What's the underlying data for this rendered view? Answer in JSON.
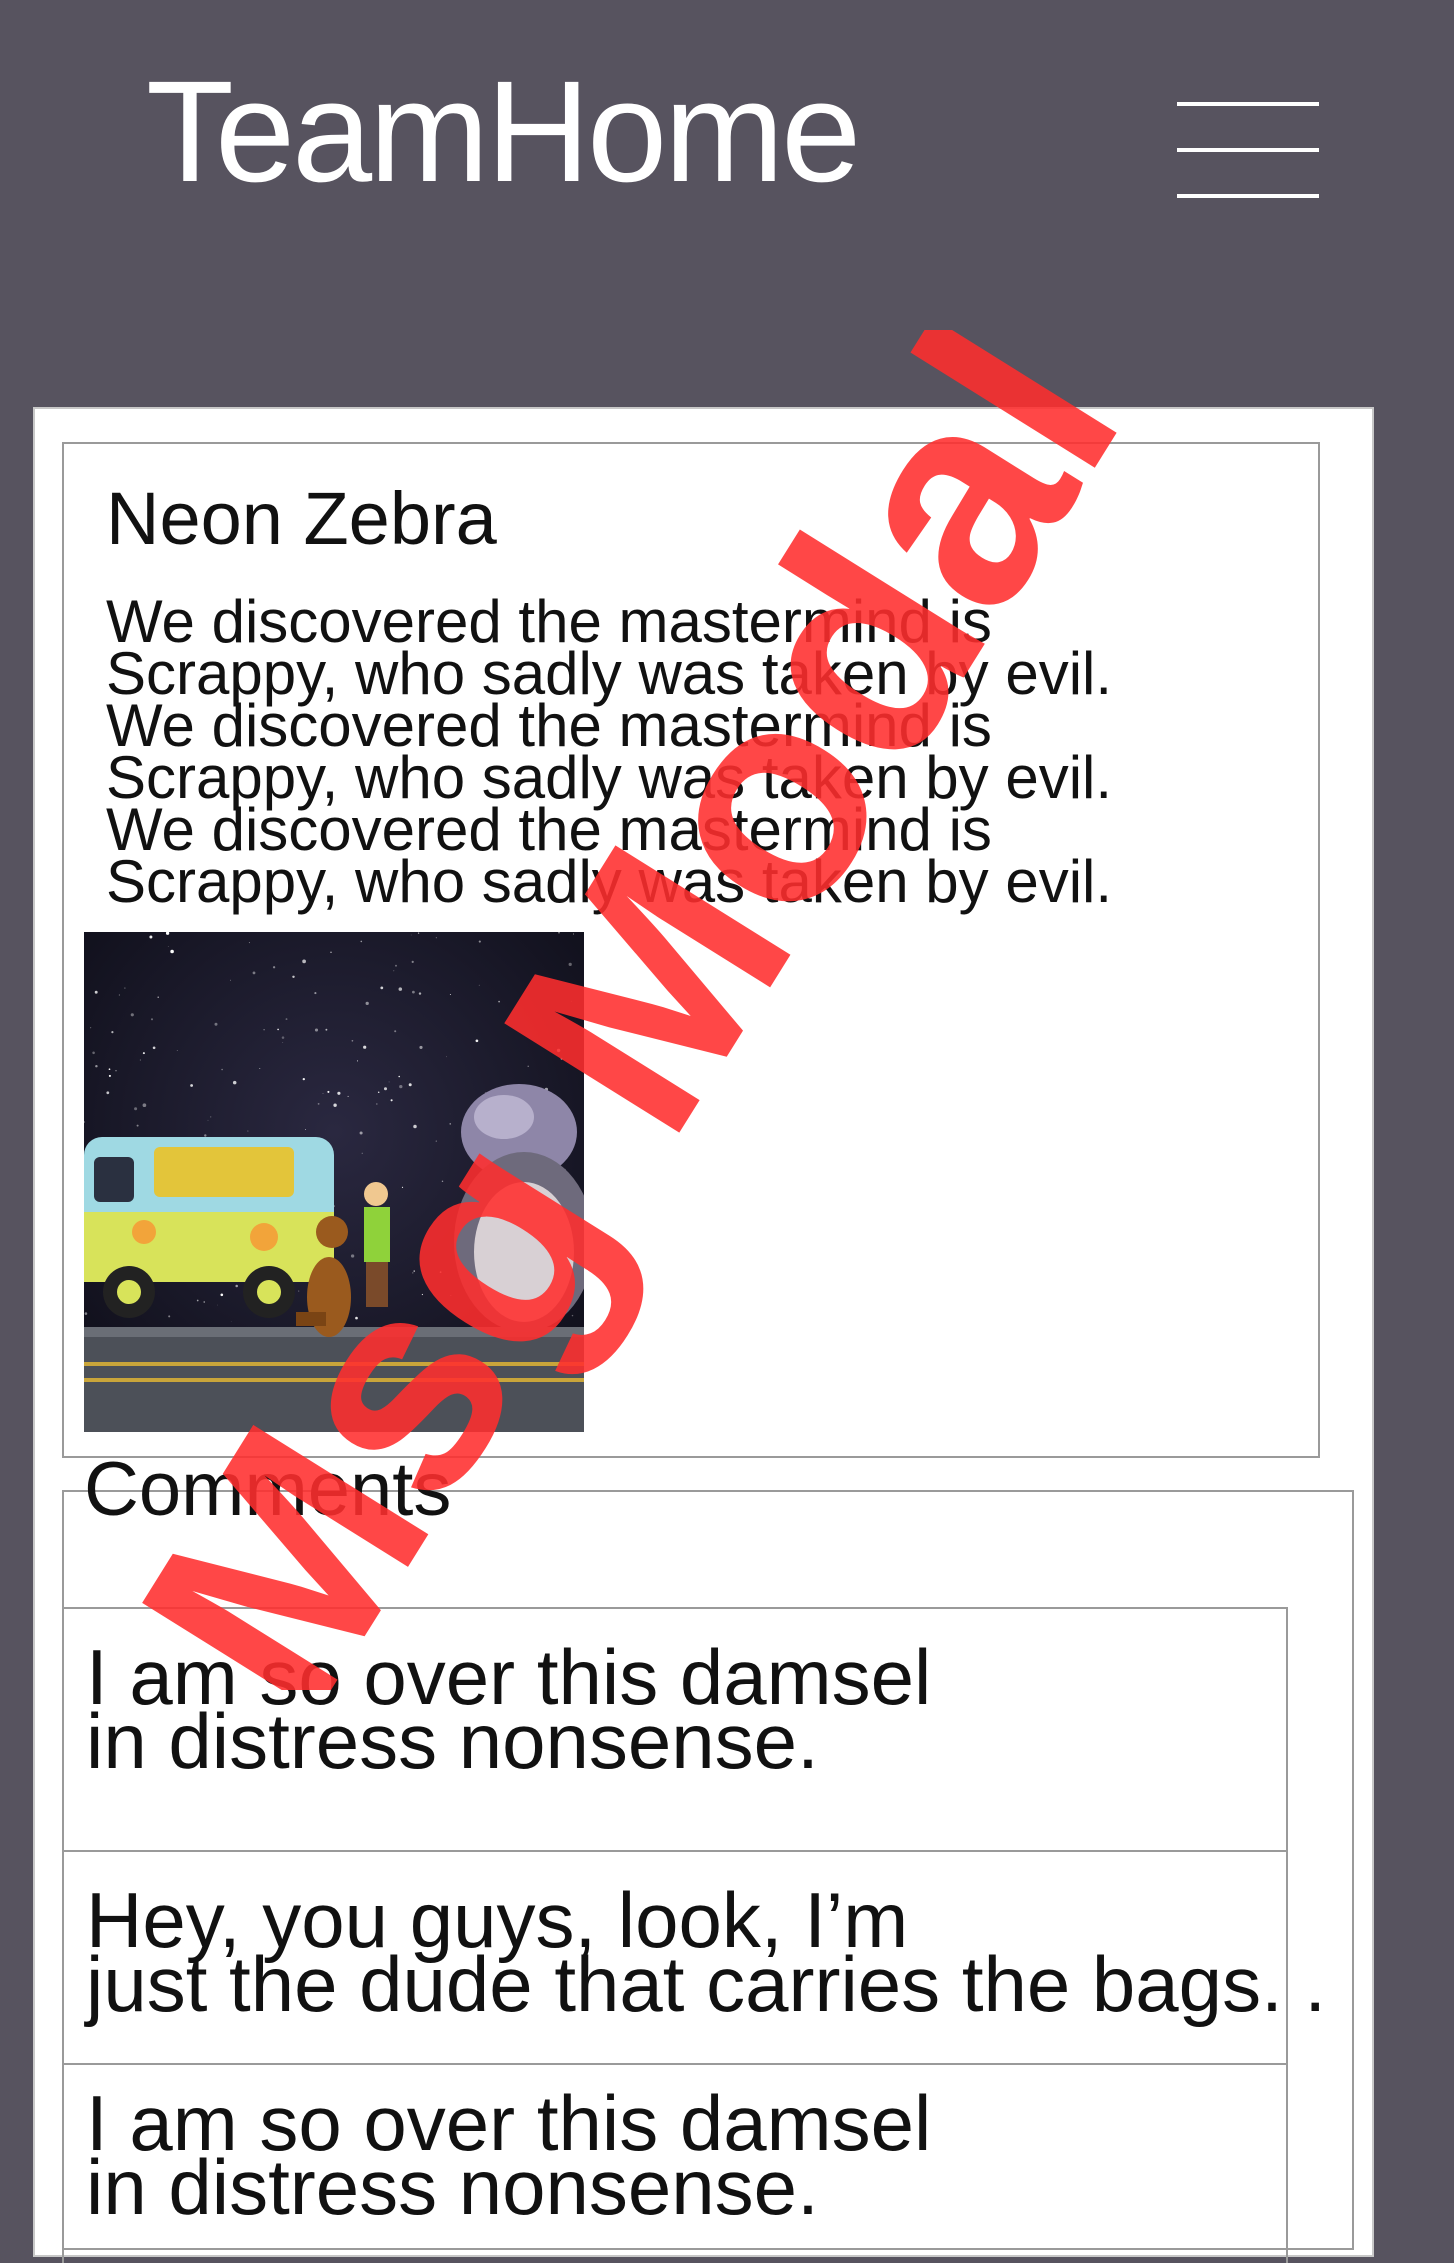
{
  "header": {
    "title": "TeamHome",
    "menu_icon": "hamburger-menu-icon"
  },
  "post": {
    "title": "Neon Zebra",
    "body_lines": [
      "We discovered the mastermind is",
      "Scrappy, who sadly was taken by evil.",
      "We discovered the mastermind is",
      "Scrappy, who sadly was taken by evil.",
      "We discovered the mastermind is",
      "Scrappy, who sadly was taken by evil."
    ],
    "image_icon": "mystery-machine-space-photo"
  },
  "comments": {
    "heading": "Comments",
    "items": [
      {
        "lines": [
          " I am so over this damsel",
          "in distress nonsense."
        ]
      },
      {
        "lines": [
          "Hey, you guys, look, I’m",
          "just the dude that carries the bags. ."
        ]
      },
      {
        "lines": [
          " I am so over this damsel",
          "in distress nonsense."
        ]
      }
    ]
  },
  "watermark": {
    "text": "Msg Modal",
    "color": "#ff2d2d"
  },
  "colors": {
    "background": "#57535f",
    "card": "#ffffff",
    "border": "#9a9a9a",
    "text": "#111111"
  }
}
